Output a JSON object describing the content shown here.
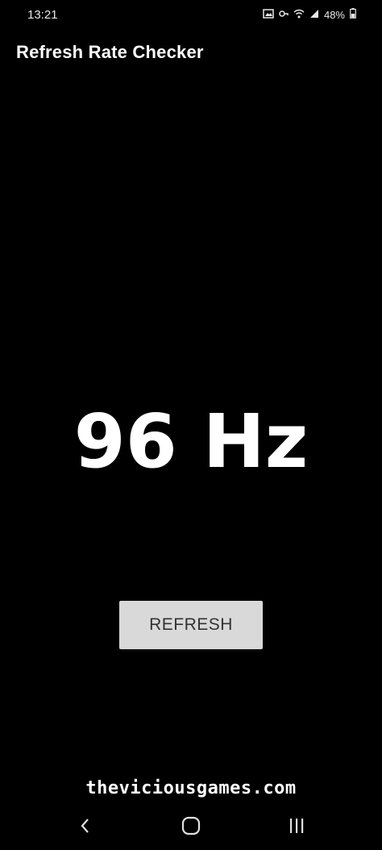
{
  "status_bar": {
    "time": "13:21",
    "battery": "48%",
    "icons": [
      "gallery-icon",
      "vpn-key-icon",
      "wifi-icon",
      "signal-icon",
      "battery-icon"
    ]
  },
  "app": {
    "title": "Refresh Rate Checker"
  },
  "main": {
    "refresh_rate": "96 Hz",
    "refresh_button_label": "REFRESH"
  },
  "watermark": {
    "text": "theviciousgames.com"
  },
  "nav_bar": {
    "icons": [
      "back-icon",
      "home-icon",
      "recents-icon"
    ]
  },
  "colors": {
    "background": "#000000",
    "text": "#ffffff",
    "button_bg": "#d9d9d9",
    "button_text": "#333333"
  }
}
